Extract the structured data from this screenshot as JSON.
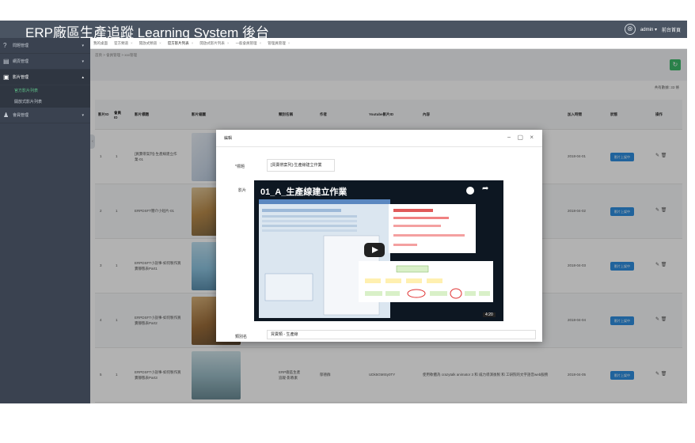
{
  "header": {
    "brand": "ERP廠區生產追蹤 Learning System 後台",
    "user": "admin ▾",
    "logout": "前台首頁",
    "logout_icon": "⊗"
  },
  "sidebar": {
    "items": [
      {
        "icon": "?",
        "label": "問題管理",
        "arrow": "▾"
      },
      {
        "icon": "▤",
        "label": "網頁管理",
        "arrow": "▾"
      },
      {
        "icon": "▣",
        "label": "影片管理",
        "arrow": "▴"
      },
      {
        "icon": "♟",
        "label": "會員管理",
        "arrow": "▾"
      }
    ],
    "subitems": [
      {
        "label": "官方影片列表"
      },
      {
        "label": "開放式影片列表"
      }
    ]
  },
  "tabs": [
    {
      "label": "我的桌面",
      "close": ""
    },
    {
      "label": "官方頻道",
      "close": "×"
    },
    {
      "label": "開放式頻道",
      "close": "×"
    },
    {
      "label": "官方影片列表",
      "close": "×"
    },
    {
      "label": "開放式影片列表",
      "close": "×"
    },
    {
      "label": "一般會員管理",
      "close": "×"
    },
    {
      "label": "管理員管理",
      "close": "×"
    }
  ],
  "breadcrumb": "首頁 > 會員管理 > xxx管理",
  "refresh_icon": "↻",
  "count_text": "共有數據: 33 條",
  "table": {
    "headers": [
      "影片ID",
      "會員ID",
      "影片標題",
      "影片縮圖",
      "類別名稱",
      "作者",
      "Youtube影片ID",
      "內容",
      "加入時間",
      "狀態",
      "操作"
    ],
    "rows": [
      {
        "vid": "1",
        "mid": "1",
        "title": "[買賣帶案列]-生產線建立作業-01",
        "cat": "",
        "author": "",
        "yt": "",
        "content": "",
        "time": "2018-04-01",
        "status": "影片上架中",
        "ops": "✎ 🗑"
      },
      {
        "vid": "2",
        "mid": "1",
        "title": "ERPDSFT簡介小短片-01",
        "cat": "",
        "author": "",
        "yt": "",
        "content": "",
        "time": "2018-04-02",
        "status": "影片上架中",
        "ops": "✎ 🗑"
      },
      {
        "vid": "3",
        "mid": "1",
        "title": "ERPDSFT小說事-如何製作買賣靜態表Part1",
        "cat": "",
        "author": "",
        "yt": "",
        "content": "",
        "time": "2018-04-03",
        "status": "影片上架中",
        "ops": "✎ 🗑"
      },
      {
        "vid": "4",
        "mid": "1",
        "title": "ERPDSFT小說事-如何製作買賣靜態表Part2",
        "cat": "",
        "author": "",
        "yt": "",
        "content": "",
        "time": "2018-04-04",
        "status": "影片上架中",
        "ops": "✎ 🗑"
      },
      {
        "vid": "5",
        "mid": "1",
        "title": "ERPDSFT小說事-如何製作買賣靜態表Part3",
        "cat": "ERP廠區生產追蹤-影教素",
        "author": "郁德群",
        "yt": "UDk5GMISy0TY",
        "content": "使用軟體為 crazytalk animator 3 和 威力導演後製 和 工研院的文字語音web服務",
        "time": "2018-04-05",
        "status": "影片上架中",
        "ops": "✎ 🗑"
      }
    ]
  },
  "modal": {
    "title": "編輯",
    "controls": "− ▢ ×",
    "title_label": "*標題",
    "title_value": "[買賣帶案列]-生產線建立作業",
    "video_label": "影片",
    "video_title": "01_A_生產線建立作業",
    "video_time": "4:20",
    "category_label": "類別名",
    "category_value": "買賣類 - 生產線"
  },
  "colors": {
    "topbar": "#4a5462",
    "sidebar": "#3a4250",
    "accent_green": "#3db96a",
    "status_blue": "#2e8fe0"
  }
}
